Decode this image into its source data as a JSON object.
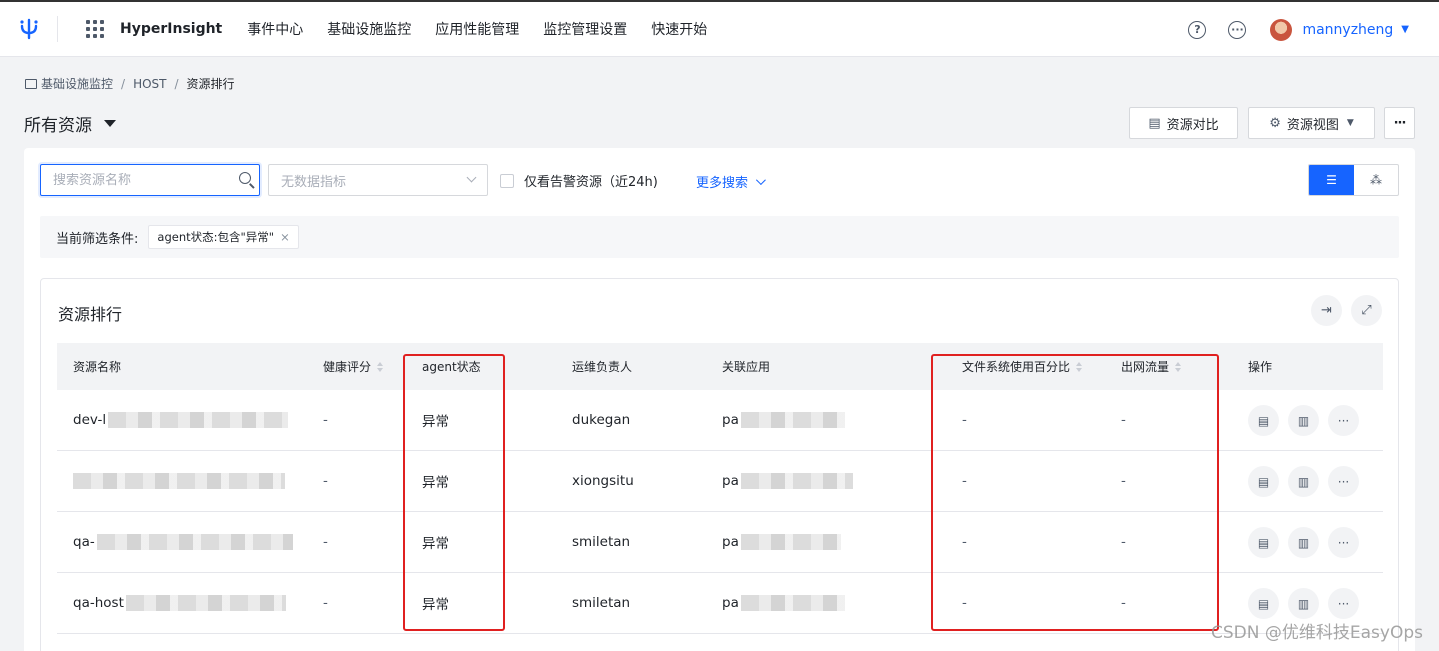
{
  "nav": {
    "brand": "HyperInsight",
    "items": [
      "事件中心",
      "基础设施监控",
      "应用性能管理",
      "监控管理设置",
      "快速开始"
    ],
    "user": "mannyzheng"
  },
  "breadcrumb": [
    "基础设施监控",
    "HOST",
    "资源排行"
  ],
  "page_title": "所有资源",
  "toolbar": {
    "compare": "资源对比",
    "view": "资源视图"
  },
  "search": {
    "placeholder": "搜索资源名称"
  },
  "metric_select": {
    "placeholder": "无数据指标"
  },
  "alert_only": {
    "label": "仅看告警资源（近24h)"
  },
  "more_search": "更多搜索",
  "filter": {
    "label": "当前筛选条件:",
    "tag": "agent状态:包含\"异常\""
  },
  "card": {
    "title": "资源排行"
  },
  "table": {
    "headers": [
      "资源名称",
      "健康评分",
      "agent状态",
      "运维负责人",
      "关联应用",
      "文件系统使用百分比",
      "出网流量",
      "操作"
    ],
    "rows": [
      {
        "name": "dev-l",
        "score": "-",
        "agent": "异常",
        "owner": "dukegan",
        "app": "pa",
        "fs": "-",
        "net": "-"
      },
      {
        "name": "",
        "score": "-",
        "agent": "异常",
        "owner": "xiongsitu",
        "app": "pa",
        "fs": "-",
        "net": "-"
      },
      {
        "name": "qa-",
        "score": "-",
        "agent": "异常",
        "owner": "smiletan",
        "app": "pa",
        "fs": "-",
        "net": "-"
      },
      {
        "name": "qa-host",
        "score": "-",
        "agent": "异常",
        "owner": "smiletan",
        "app": "pa",
        "fs": "-",
        "net": "-"
      }
    ]
  },
  "watermark": "CSDN @优维科技EasyOps",
  "colors": {
    "accent": "#1664ff",
    "highlight": "#e02020"
  }
}
